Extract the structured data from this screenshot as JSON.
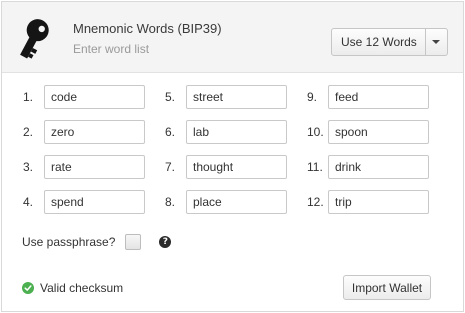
{
  "header": {
    "icon": "key-icon",
    "title": "Mnemonic Words (BIP39)",
    "subtitle": "Enter word list",
    "word_count_button": "Use 12 Words",
    "word_count_caret_icon": "caret-down-icon"
  },
  "words": [
    {
      "num": "1.",
      "value": "code"
    },
    {
      "num": "2.",
      "value": "zero"
    },
    {
      "num": "3.",
      "value": "rate"
    },
    {
      "num": "4.",
      "value": "spend"
    },
    {
      "num": "5.",
      "value": "street"
    },
    {
      "num": "6.",
      "value": "lab"
    },
    {
      "num": "7.",
      "value": "thought"
    },
    {
      "num": "8.",
      "value": "place"
    },
    {
      "num": "9.",
      "value": "feed"
    },
    {
      "num": "10.",
      "value": "spoon"
    },
    {
      "num": "11.",
      "value": "drink"
    },
    {
      "num": "12.",
      "value": "trip"
    }
  ],
  "passphrase": {
    "label": "Use passphrase?",
    "checked": false,
    "help_icon": "question-circle-icon",
    "help_glyph": "?"
  },
  "status": {
    "icon": "check-circle-icon",
    "text": "Valid checksum",
    "color": "#4caf50"
  },
  "actions": {
    "import_label": "Import Wallet"
  }
}
